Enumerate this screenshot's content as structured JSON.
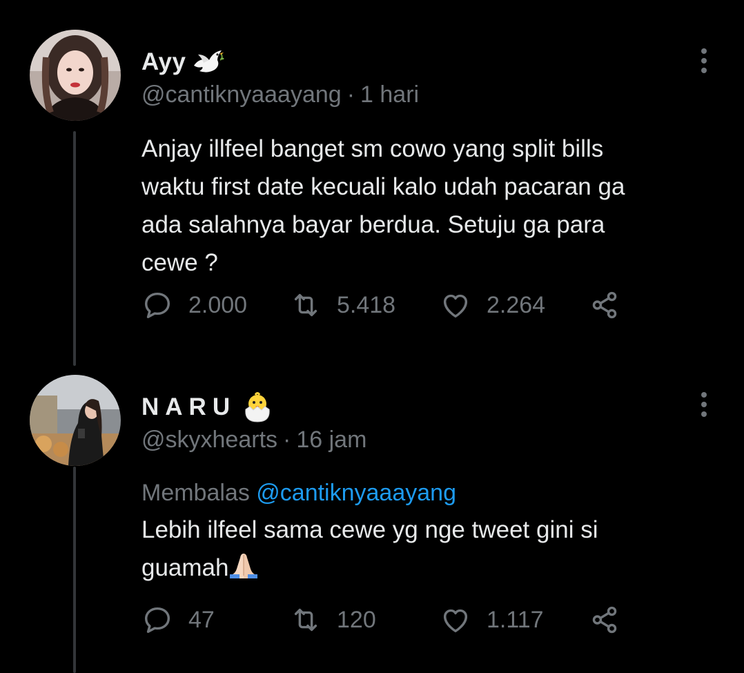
{
  "tweets": [
    {
      "display_name": "Ayy",
      "name_emoji": "dove-emoji",
      "handle": "@cantiknyaaayang",
      "separator": "·",
      "time": "1 hari",
      "text": "Anjay illfeel banget sm cowo yang split bills\nwaktu first date kecuali kalo udah pacaran ga\nada salahnya bayar berdua. Setuju ga para\ncewe ?",
      "replies": "2.000",
      "retweets": "5.418",
      "likes": "2.264"
    },
    {
      "display_name": "NARU",
      "name_emoji": "hatching-chick-emoji",
      "handle": "@skyxhearts",
      "separator": "·",
      "time": "16 jam",
      "reply_prefix": "Membalas ",
      "reply_mention": "@cantiknyaaayang",
      "text_line1": "Lebih ilfeel sama cewe yg nge tweet gini si",
      "text_line2": "guamah",
      "text_emoji": "folded-hands-emoji",
      "replies": "47",
      "retweets": "120",
      "likes": "1.117"
    }
  ],
  "colors": {
    "background": "#000000",
    "primary_text": "#e7e9ea",
    "secondary_text": "#71767b",
    "mention": "#1d9bf0",
    "thread_line": "#333639"
  }
}
